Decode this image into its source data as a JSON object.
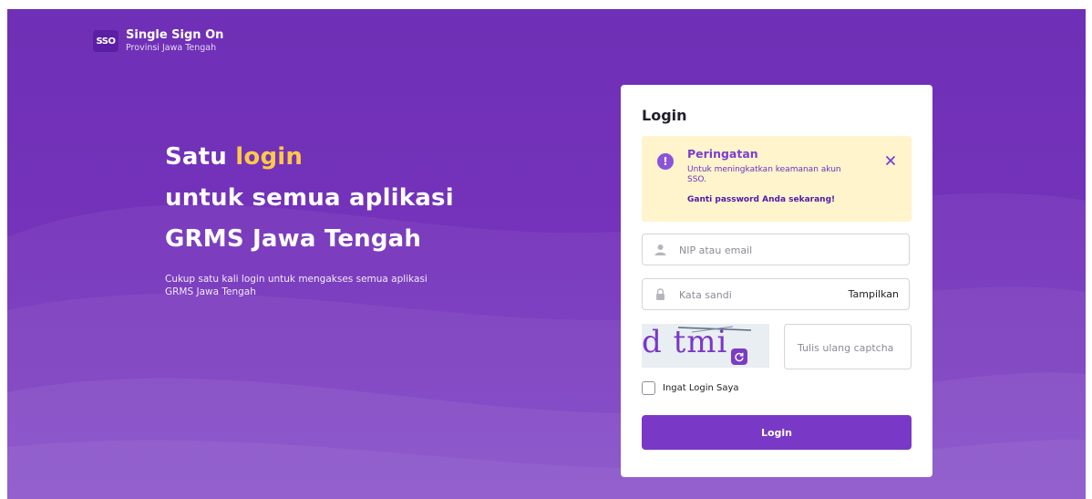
{
  "brand": {
    "logo_text": "SSO",
    "title": "Single Sign On",
    "subtitle": "Provinsi Jawa Tengah"
  },
  "hero": {
    "line1_prefix": "Satu",
    "line1_accent": "login",
    "line2": "untuk semua aplikasi",
    "line3": "GRMS Jawa Tengah",
    "description": "Cukup satu kali login untuk mengakses semua aplikasi GRMS Jawa Tengah"
  },
  "login_card": {
    "title": "Login",
    "alert": {
      "icon": "exclamation-icon",
      "title": "Peringatan",
      "message": "Untuk meningkatkan keamanan akun SSO.",
      "link": "Ganti password Anda sekarang!"
    },
    "username": {
      "placeholder": "NIP atau email",
      "value": "",
      "icon": "user-icon"
    },
    "password": {
      "placeholder": "Kata sandi",
      "value": "",
      "icon": "lock-icon",
      "toggle_label": "Tampilkan"
    },
    "captcha": {
      "image_text": "d tmi",
      "input_placeholder": "Tulis ulang captcha",
      "refresh_icon": "refresh-icon"
    },
    "remember_label": "Ingat Login Saya",
    "remember_checked": false,
    "submit_label": "Login"
  },
  "colors": {
    "brand_purple": "#7433ba",
    "accent_yellow": "#ffc84a",
    "alert_bg": "#fff4cc",
    "button": "#7a38c6"
  }
}
